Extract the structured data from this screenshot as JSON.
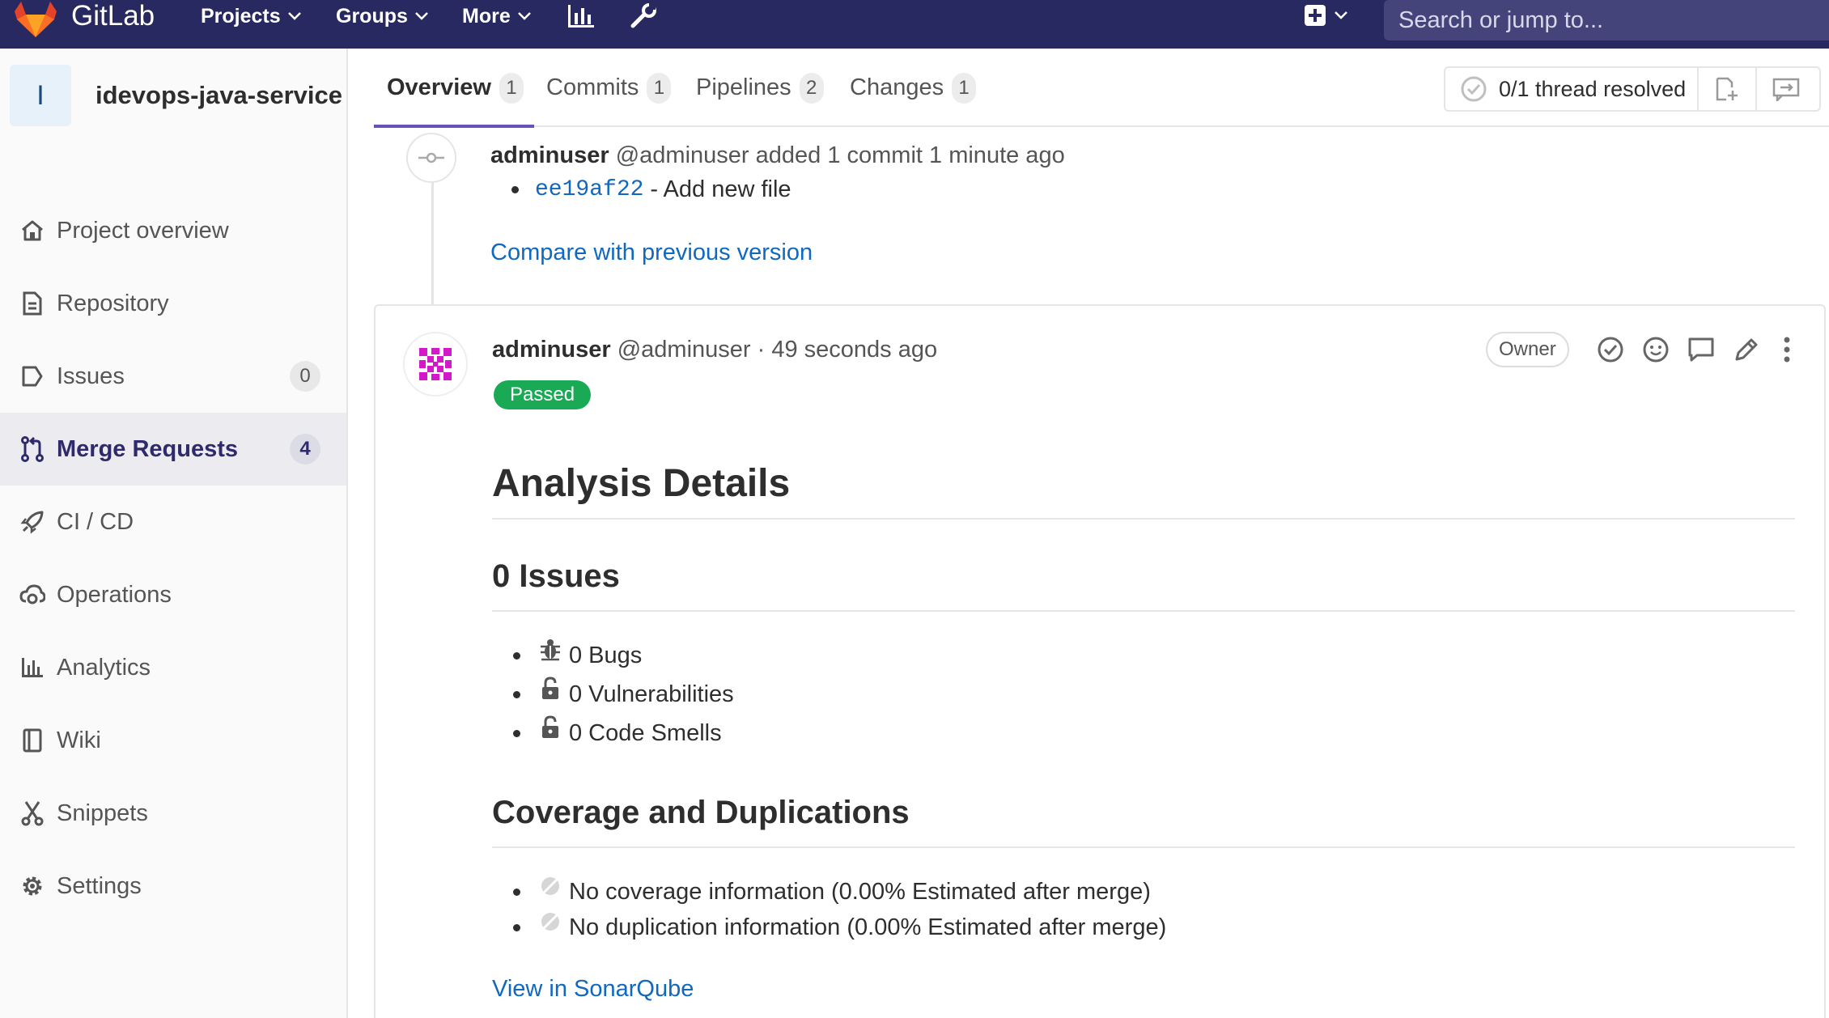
{
  "navbar": {
    "brand": "GitLab",
    "projects": "Projects",
    "groups": "Groups",
    "more": "More",
    "search_placeholder": "Search or jump to..."
  },
  "sidebar": {
    "project_initial": "I",
    "project_name": "idevops-java-service",
    "items": [
      {
        "label": "Project overview",
        "icon": "home-icon"
      },
      {
        "label": "Repository",
        "icon": "doc-icon"
      },
      {
        "label": "Issues",
        "icon": "issues-icon",
        "count": "0"
      },
      {
        "label": "Merge Requests",
        "icon": "merge-request-icon",
        "count": "4"
      },
      {
        "label": "CI / CD",
        "icon": "rocket-icon"
      },
      {
        "label": "Operations",
        "icon": "cloud-gear-icon"
      },
      {
        "label": "Analytics",
        "icon": "chart-icon"
      },
      {
        "label": "Wiki",
        "icon": "book-icon"
      },
      {
        "label": "Snippets",
        "icon": "scissors-icon"
      },
      {
        "label": "Settings",
        "icon": "gear-icon"
      }
    ]
  },
  "tabs": [
    {
      "label": "Overview",
      "count": "1"
    },
    {
      "label": "Commits",
      "count": "1"
    },
    {
      "label": "Pipelines",
      "count": "2"
    },
    {
      "label": "Changes",
      "count": "1"
    }
  ],
  "thread_status": "0/1 thread resolved",
  "system_note": {
    "author": "adminuser",
    "username": "@adminuser",
    "text": "added 1 commit 1 minute ago",
    "commit_sha": "ee19af22",
    "commit_msg": "- Add new file",
    "compare_link": "Compare with previous version"
  },
  "note": {
    "author": "adminuser",
    "username": "@adminuser",
    "time": "· 49 seconds ago",
    "owner_badge": "Owner",
    "status_badge": "Passed",
    "title": "Analysis Details",
    "issues_heading": "0 Issues",
    "issues": [
      "0 Bugs",
      "0 Vulnerabilities",
      "0 Code Smells"
    ],
    "coverage_heading": "Coverage and Duplications",
    "coverage": [
      "No coverage information (0.00% Estimated after merge)",
      "No duplication information (0.00% Estimated after merge)"
    ],
    "sonar_link": "View in SonarQube"
  },
  "colors": {
    "navbar": "#292961",
    "link": "#1068bf",
    "passed": "#1aaa55",
    "active_tab": "#6b4fbb"
  }
}
